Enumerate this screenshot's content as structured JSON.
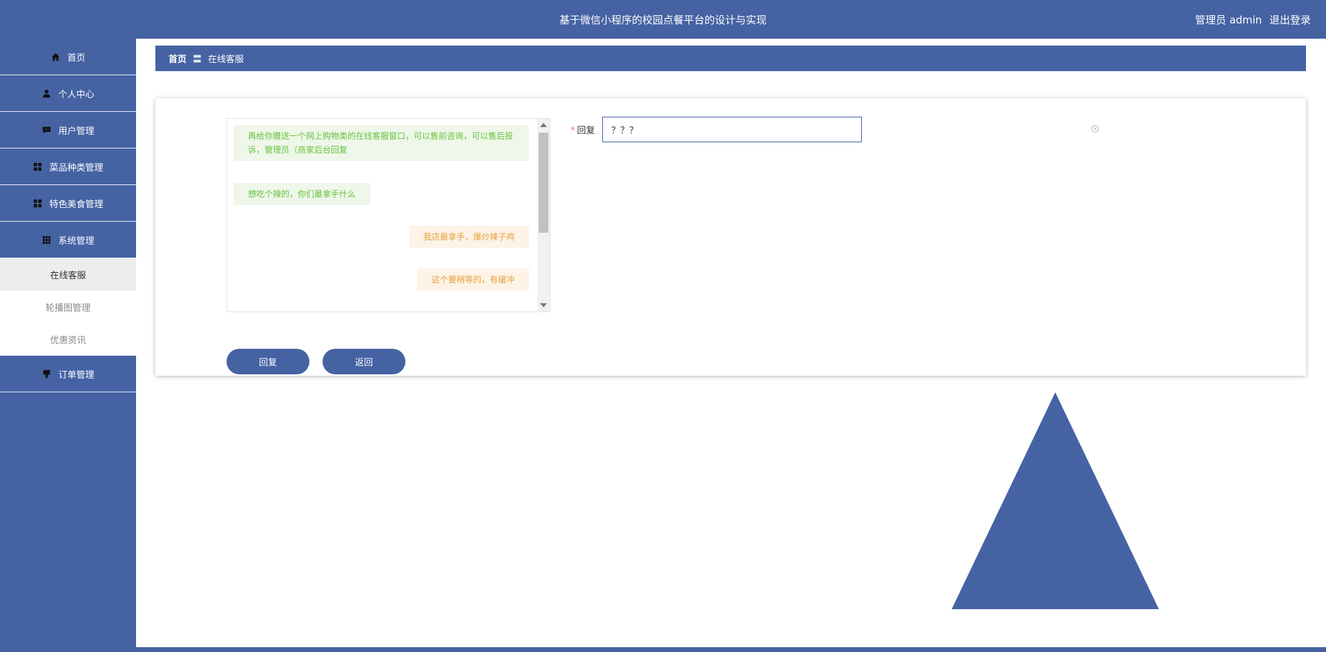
{
  "header": {
    "title": "基于微信小程序的校园点餐平台的设计与实现",
    "user_label": "管理员 admin",
    "logout_label": "退出登录"
  },
  "sidebar": {
    "items": [
      {
        "label": "首页",
        "icon": "home-icon"
      },
      {
        "label": "个人中心",
        "icon": "user-icon"
      },
      {
        "label": "用户管理",
        "icon": "chat-icon"
      },
      {
        "label": "菜品种类管理",
        "icon": "grid-icon"
      },
      {
        "label": "特色美食管理",
        "icon": "grid-icon"
      },
      {
        "label": "系统管理",
        "icon": "apps-icon"
      }
    ],
    "submenu": [
      {
        "label": "在线客服",
        "active": true
      },
      {
        "label": "轮播图管理"
      },
      {
        "label": "优惠资讯"
      }
    ],
    "after": [
      {
        "label": "订单管理",
        "icon": "order-icon"
      }
    ]
  },
  "breadcrumb": {
    "home": "首页",
    "separator": "〓",
    "current": "在线客服"
  },
  "chat": {
    "messages": [
      {
        "side": "left",
        "text": "再给你赠送一个网上购物类的在线客服窗口，可以售前咨询，可以售后投诉，管理员（商家后台回复"
      },
      {
        "side": "left",
        "text": "想吃个辣的，你们最拿手什么"
      },
      {
        "side": "right",
        "text": "我店最拿手，爆炒辣子鸡"
      },
      {
        "side": "right",
        "text": "这个要稍等的，有缓冲"
      }
    ]
  },
  "form": {
    "required_mark": "*",
    "reply_label": "回复",
    "reply_value": "？？？"
  },
  "buttons": {
    "reply": "回复",
    "back": "返回"
  },
  "colors": {
    "primary": "#4563a3",
    "left_bubble_bg": "#eef7ea",
    "left_bubble_text": "#67c23a",
    "right_bubble_bg": "#fdf3e6",
    "right_bubble_text": "#e6a23c"
  }
}
